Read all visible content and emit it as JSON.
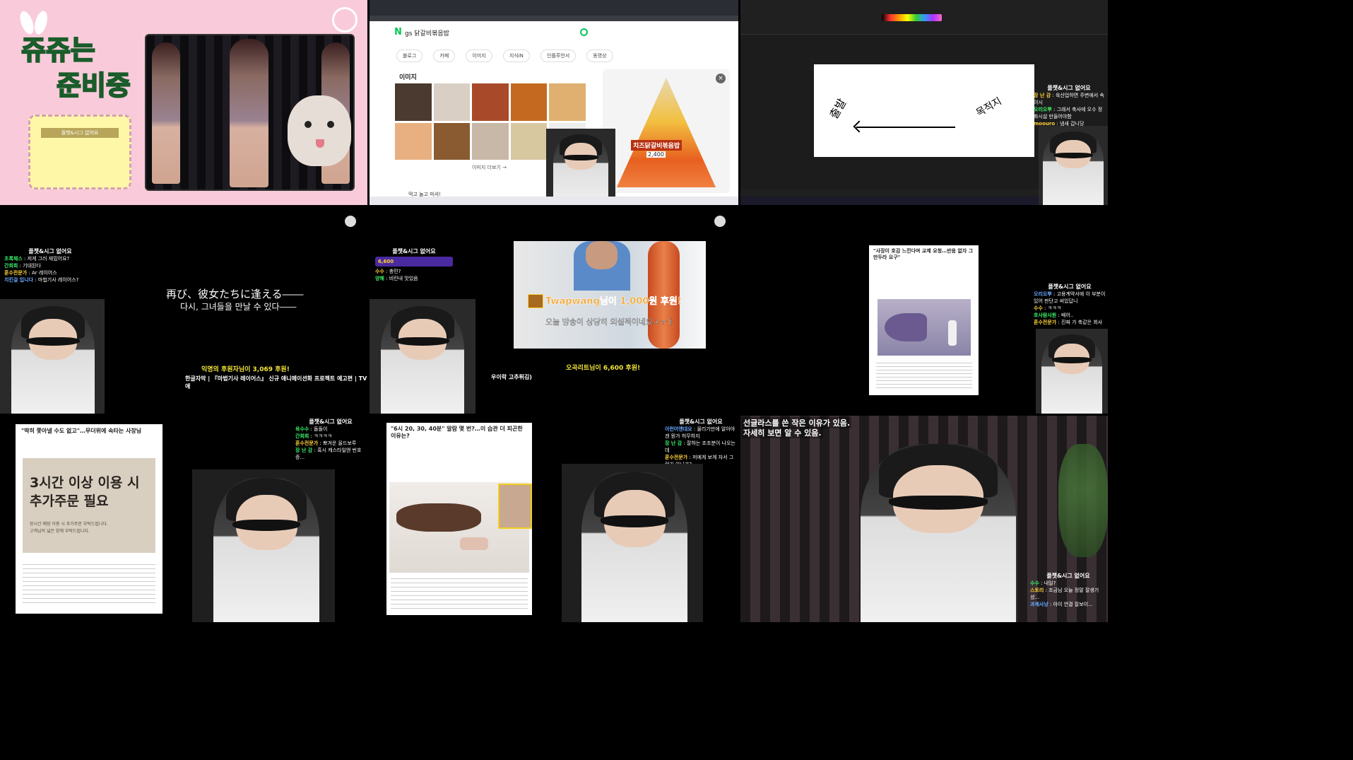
{
  "cell1": {
    "title_line1": "쥬쥬는",
    "title_line2": "준비중",
    "chat_label": "플챗&시그 없어요",
    "colors": {
      "bg": "#f7c6d6",
      "title": "#4ad86a",
      "box": "#fff7a8"
    }
  },
  "cell2": {
    "search_query": "gs 닭갈비볶음밥",
    "search_logo": "N",
    "tabs": [
      "블로그",
      "카페",
      "이미지",
      "지식iN",
      "인플루언서",
      "동영상"
    ],
    "section_title": "이미지",
    "more_images": "이미지 더보기 →",
    "bottom_text": "먹고 놀고 마셔!",
    "product_label": "치즈닭갈비볶음밥",
    "product_price": "2,400",
    "chat_label": "플챗&시그 없어요"
  },
  "cell3": {
    "drawing_text_left": "출발",
    "drawing_text_right": "목적지",
    "chat_label": "플챗&시그 없어요",
    "chat": [
      {
        "user": "장 난 감",
        "msg": "육산업하면 주변에서 속이시"
      },
      {
        "user": "오리오뿌",
        "msg": "그래서 축사에 오수 정화시설 만들어야함"
      },
      {
        "user": "moouro",
        "msg": "냄새 갑니당"
      }
    ]
  },
  "cell4": {
    "subtitle_jp": "再び、彼女たちに逢える――",
    "subtitle_kr": "다시, 그녀들을 만날 수 있다――",
    "donation_user": "익명의 후원자",
    "donation_amount": "3,069 후원!",
    "caption": "한글자막 | 『마법기사 레이어스』 신규 애니메이션화 프로젝트 예고편 | TV 애",
    "chat_label": "플챗&시그 없어요",
    "chat": [
      {
        "user": "초록체스",
        "msg": "저게 그러 재밌어요?"
      },
      {
        "user": "간희희",
        "msg": "기대된다"
      },
      {
        "user": "훈수전문가",
        "msg": "Ar 레이어스"
      },
      {
        "user": "치킨걸 입니다",
        "msg": "마법기사 레이어스?"
      }
    ]
  },
  "cell5": {
    "video_donation": "Twapwang님이 1,000원 후원!",
    "video_message": "오늘 방송이 상당히 외설적이네요ㅗㅜㅑ",
    "donation_user": "오곡리트",
    "donation_amount": "6,600 후원!",
    "caption": "우이락 고추튀김)",
    "chat_label": "플챗&시그 없어요",
    "chat": [
      {
        "user": "수수",
        "msg": "충민?"
      },
      {
        "user": "양해",
        "msg": "비린내 맛있음"
      }
    ],
    "badge_amount": "6,600"
  },
  "cell6": {
    "article_title": "\"사장이 호감 느낀다며 교제 요청…반응 없자 그만두라 요구\"",
    "chat_label": "플챗&시그 없어요",
    "chat": [
      {
        "user": "오리오뿌",
        "msg": "고용계약서에 이 부분이 있어 판단고 써있답니"
      },
      {
        "user": "수수",
        "msg": "ㅋㅋㅋ"
      },
      {
        "user": "호사람사원",
        "msg": "배어.."
      },
      {
        "user": "훈수전문가",
        "msg": "진짜 가 축같은 회사"
      }
    ]
  },
  "cell7": {
    "article_title": "\"딱히 쫓아낼 수도 없고\"…무더위에 속타는 사장님",
    "sign_line1": "3시간 이상 이용 시",
    "sign_line2": "추가주문 필요",
    "sign_sub1": "장시간 매장 이용 시 추가주문 부탁드립니다.",
    "sign_sub2": "고객님의 넓은 양해 부탁드립니다.",
    "chat_label": "플챗&시그 없어요",
    "chat": [
      {
        "user": "육수수",
        "msg": "돌돌이"
      },
      {
        "user": "간희희",
        "msg": "ㅋㅋㅋㅋ"
      },
      {
        "user": "훈수전문가",
        "msg": "뽀겨운 울드보루"
      },
      {
        "user": "장 난 감",
        "msg": "혹시 캐스타일앤 번호증..."
      }
    ]
  },
  "cell8": {
    "article_title": "\"6시 20, 30, 40분\" 알람 몇 번?…이 습관 더 피곤한 이유는?",
    "chat_label": "플챗&시그 없어요",
    "chat": [
      {
        "user": "이런어앤대요",
        "msg": "올리기만에 알아야겐 뭔가 허무하지"
      },
      {
        "user": "장 난 감",
        "msg": "잘하는 조조분이 나오는데"
      },
      {
        "user": "훈수전문가",
        "msg": "저에게 보게 자서 그런거 아닌가?"
      }
    ]
  },
  "cell9": {
    "caption_line1": "선글라스를 쓴 작은 이유가 있음.",
    "caption_line2": "자세히 보면 알 수 있음.",
    "chat_label": "플챗&시그 없어요",
    "chat": [
      {
        "user": "수수",
        "msg": "내일?"
      },
      {
        "user": "스토리",
        "msg": "조금님 오늘 정말 잘생기셨..."
      },
      {
        "user": "과제사냥",
        "msg": "아이 연결 잘보이..."
      }
    ]
  }
}
